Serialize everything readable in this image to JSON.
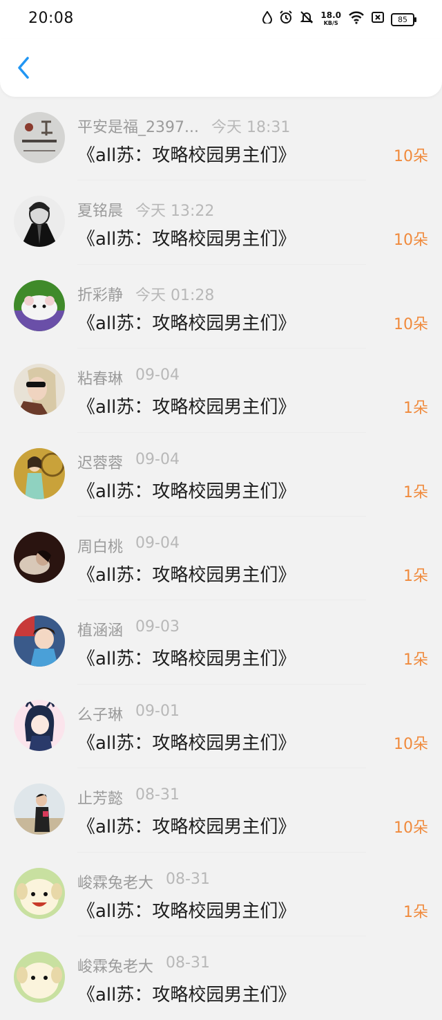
{
  "status_bar": {
    "time": "20:08",
    "net_speed": "18.0",
    "net_unit": "KB/S",
    "battery": "85"
  },
  "nav": {
    "back_icon": "chevron-left-icon"
  },
  "list": [
    {
      "name": "平安是福_2397...",
      "time": "今天 18:31",
      "title": "《all苏：攻略校园男主们》",
      "amount": "10朵"
    },
    {
      "name": "夏铭晨",
      "time": "今天 13:22",
      "title": "《all苏：攻略校园男主们》",
      "amount": "10朵"
    },
    {
      "name": "折彩静",
      "time": "今天 01:28",
      "title": "《all苏：攻略校园男主们》",
      "amount": "10朵"
    },
    {
      "name": "粘春琳",
      "time": "09-04",
      "title": "《all苏：攻略校园男主们》",
      "amount": "1朵"
    },
    {
      "name": "迟蓉蓉",
      "time": "09-04",
      "title": "《all苏：攻略校园男主们》",
      "amount": "1朵"
    },
    {
      "name": "周白桃",
      "time": "09-04",
      "title": "《all苏：攻略校园男主们》",
      "amount": "1朵"
    },
    {
      "name": "植涵涵",
      "time": "09-03",
      "title": "《all苏：攻略校园男主们》",
      "amount": "1朵"
    },
    {
      "name": "么子琳",
      "time": "09-01",
      "title": "《all苏：攻略校园男主们》",
      "amount": "10朵"
    },
    {
      "name": "止芳懿",
      "time": "08-31",
      "title": "《all苏：攻略校园男主们》",
      "amount": "10朵"
    },
    {
      "name": "峻霖兔老大",
      "time": "08-31",
      "title": "《all苏：攻略校园男主们》",
      "amount": "1朵"
    },
    {
      "name": "峻霖兔老大",
      "time": "08-31",
      "title": "《all苏：攻略校园男主们》",
      "amount": ""
    }
  ],
  "colors": {
    "accent": "#f08a3c",
    "back": "#2196f3"
  }
}
